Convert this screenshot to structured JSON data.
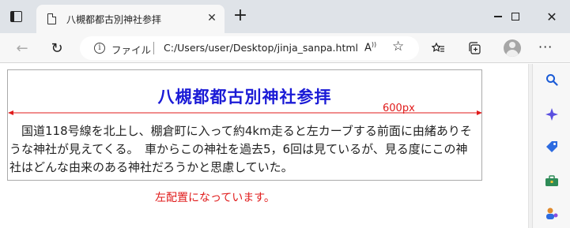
{
  "browser": {
    "tab_title": "八槻都都古別神社参拝",
    "address": {
      "file_label": "ファイル",
      "url": "C:/Users/user/Desktop/jinja_sanpa.html"
    },
    "icons": {
      "tab_actions": "tab-actions-icon",
      "favicon": "page-icon",
      "close_tab": "close-icon",
      "new_tab": "plus-icon",
      "back": "arrow-left-icon",
      "refresh": "refresh-icon",
      "site_info": "info-icon",
      "read_aloud": "read-aloud-icon",
      "add_favorite": "star-plus-icon",
      "favorites": "favorites-icon",
      "collections": "collections-icon",
      "profile": "profile-icon",
      "more": "more-icon"
    },
    "sidebar": [
      "search-icon",
      "copilot-icon",
      "shopping-tag-icon",
      "tools-icon",
      "games-icon"
    ],
    "accent_color": "#1a1ad6",
    "annotation_color": "#e01b1b"
  },
  "page": {
    "heading": "八槻都都古別神社参拝",
    "width_label": "600px",
    "paragraph": "国道118号線を北上し、棚倉町に入って約4km走ると左カーブする前面に由緒ありそうな神社が見えてくる。　車からこの神社を過去5，6回は見ているが、見る度にこの神社はどんな由来のある神社だろうかと思慮していた。",
    "alignment_note": "左配置になっています。"
  }
}
